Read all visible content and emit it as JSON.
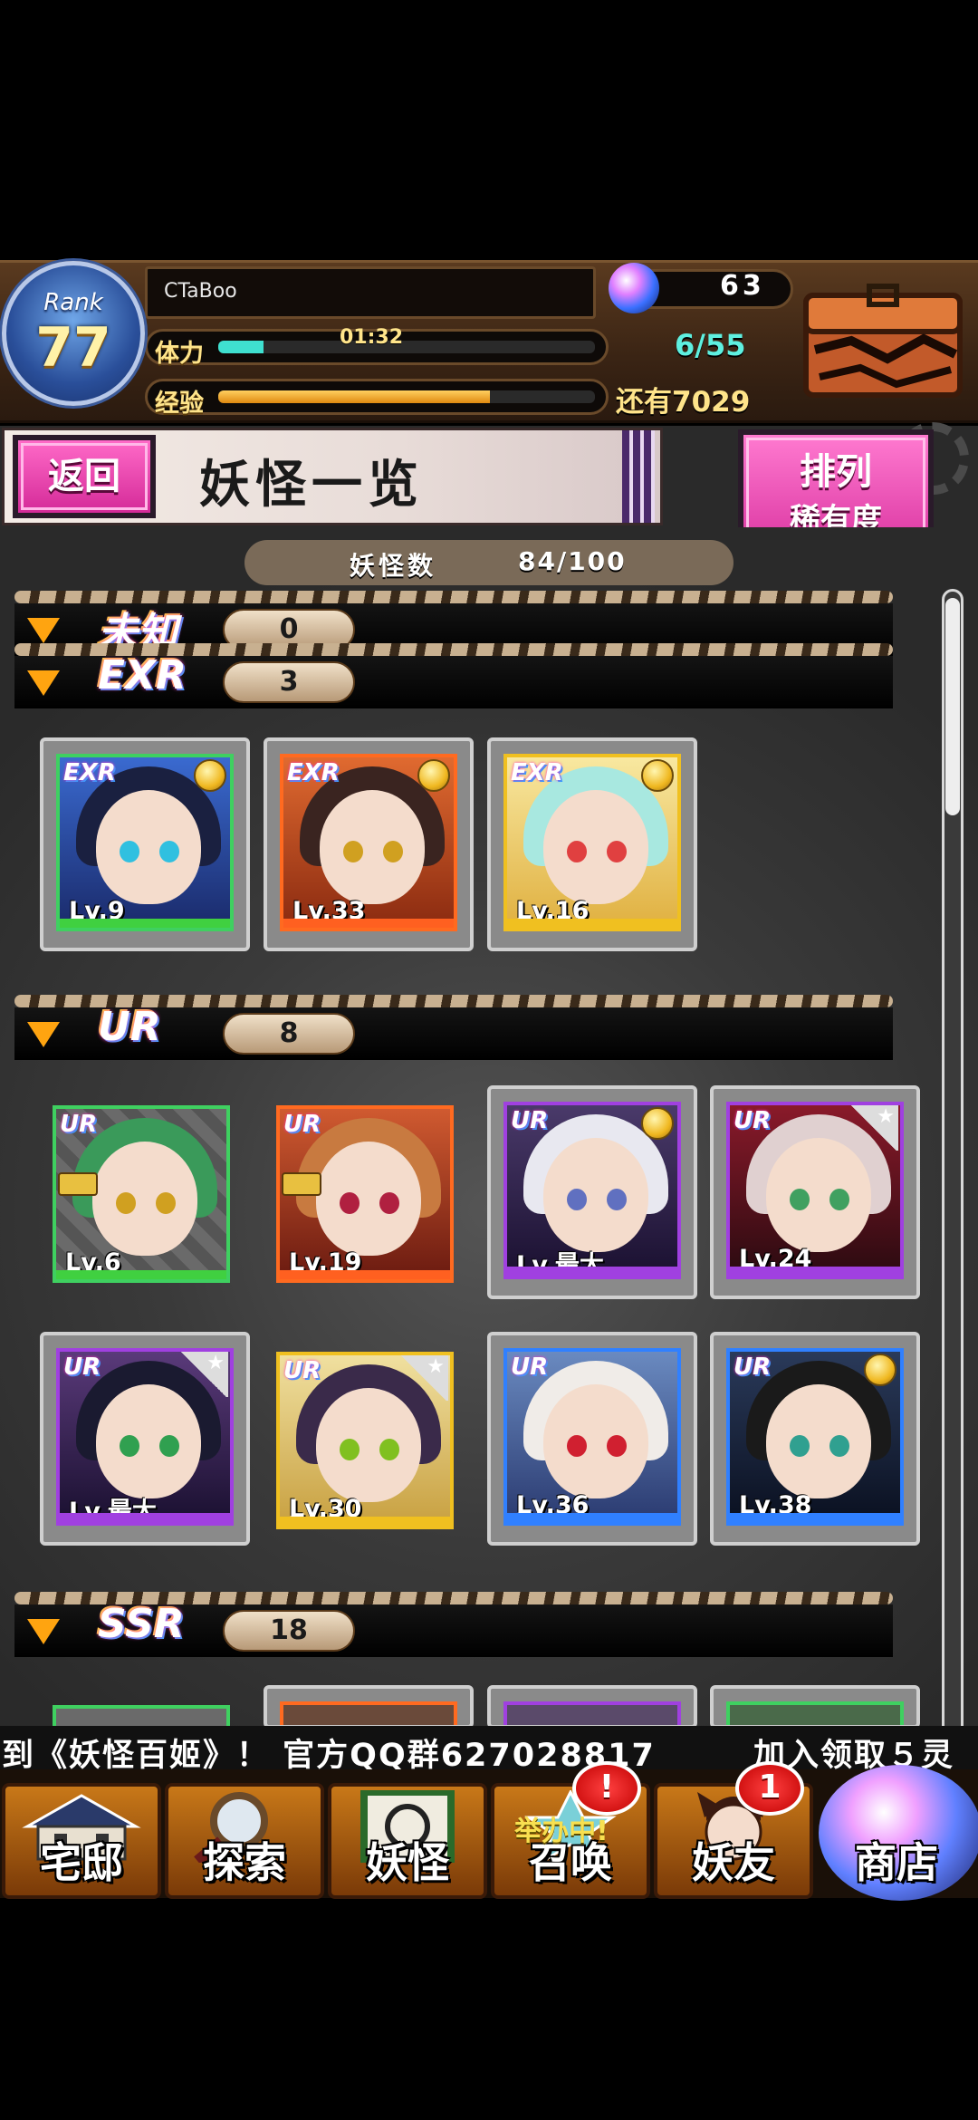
{
  "status": {
    "rank_word": "Rank",
    "rank": "77",
    "player_name": "CTaBoo",
    "stamina_label": "体力",
    "stamina_timer": "01:32",
    "stamina_fraction": 0.12,
    "stamina_count": "6/55",
    "exp_label": "经验",
    "exp_fraction": 0.72,
    "orb_count": "63",
    "exp_remaining": "还有7029"
  },
  "header": {
    "back_label": "返回",
    "title": "妖怪一览",
    "sort_line1": "排列",
    "sort_line2": "稀有度"
  },
  "summary": {
    "label": "妖怪数",
    "value": "84/100"
  },
  "sections": [
    {
      "rarity": "未知",
      "count": "0"
    },
    {
      "rarity": "EXR",
      "count": "3"
    },
    {
      "rarity": "UR",
      "count": "8"
    },
    {
      "rarity": "SSR",
      "count": "18"
    }
  ],
  "cards_exr": [
    {
      "tag": "EXR",
      "level": "Lv.9"
    },
    {
      "tag": "EXR",
      "level": "Lv.33"
    },
    {
      "tag": "EXR",
      "level": "Lv.16"
    }
  ],
  "cards_ur": [
    {
      "tag": "UR",
      "level": "Lv.6"
    },
    {
      "tag": "UR",
      "level": "Lv.19"
    },
    {
      "tag": "UR",
      "level": "Lv.最大"
    },
    {
      "tag": "UR",
      "level": "Lv.24"
    },
    {
      "tag": "UR",
      "level": "Lv.最大"
    },
    {
      "tag": "UR",
      "level": "Lv.30"
    },
    {
      "tag": "UR",
      "level": "Lv.36"
    },
    {
      "tag": "UR",
      "level": "Lv.38"
    }
  ],
  "ticker": {
    "left": "到《妖怪百姬》！ 官方QQ群627028817",
    "right": "加入领取５灵"
  },
  "nav": [
    {
      "label": "宅邸"
    },
    {
      "label": "探索"
    },
    {
      "label": "妖怪"
    },
    {
      "label": "召唤",
      "badge": "!"
    },
    {
      "label": "妖友",
      "badge": "1"
    },
    {
      "label": "商店"
    }
  ],
  "summon_banner": "举办中!",
  "colors": {
    "accent_pink": "#e040a8",
    "stamina": "#3fe0d0",
    "exp": "#f0a020",
    "nav_orange": "#c87818"
  }
}
